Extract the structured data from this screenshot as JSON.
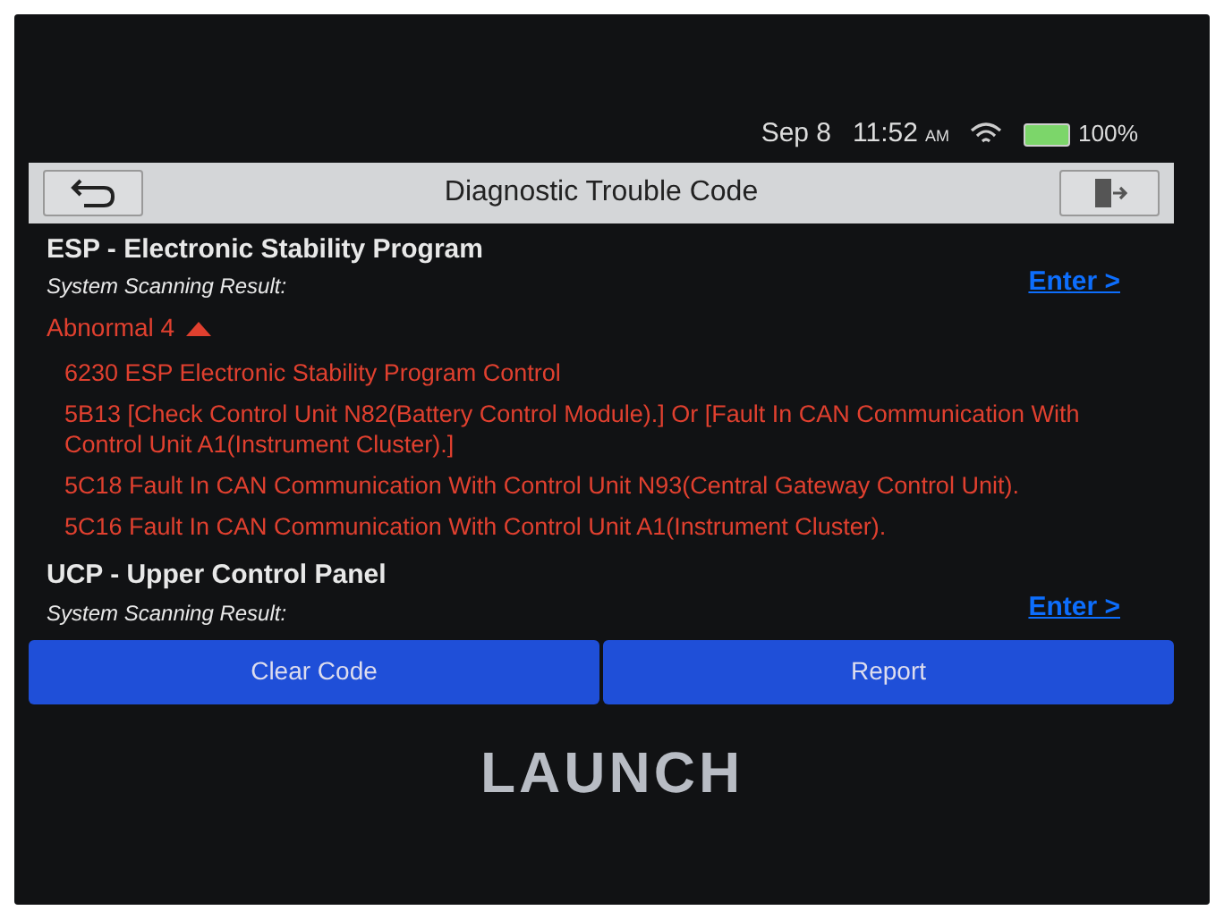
{
  "status_bar": {
    "date": "Sep 8",
    "time": "11:52",
    "meridiem": "AM",
    "battery": "100%"
  },
  "title_bar": {
    "title": "Diagnostic Trouble Code"
  },
  "systems": [
    {
      "name": "ESP - Electronic Stability Program",
      "result_label": "System Scanning Result:",
      "enter": "Enter >",
      "status": "Abnormal 4",
      "expanded": true,
      "codes": [
        "6230 ESP Electronic Stability Program Control",
        "5B13 [Check Control Unit N82(Battery Control Module).] Or [Fault In CAN Communication With Control Unit A1(Instrument Cluster).]",
        "5C18 Fault In CAN Communication With Control Unit N93(Central Gateway Control Unit).",
        "5C16 Fault In CAN Communication With Control Unit A1(Instrument Cluster)."
      ]
    },
    {
      "name": "UCP - Upper Control Panel",
      "result_label": "System Scanning Result:",
      "enter": "Enter >"
    }
  ],
  "buttons": [
    "Clear Code",
    "Report"
  ],
  "brand": "LAUNCH"
}
